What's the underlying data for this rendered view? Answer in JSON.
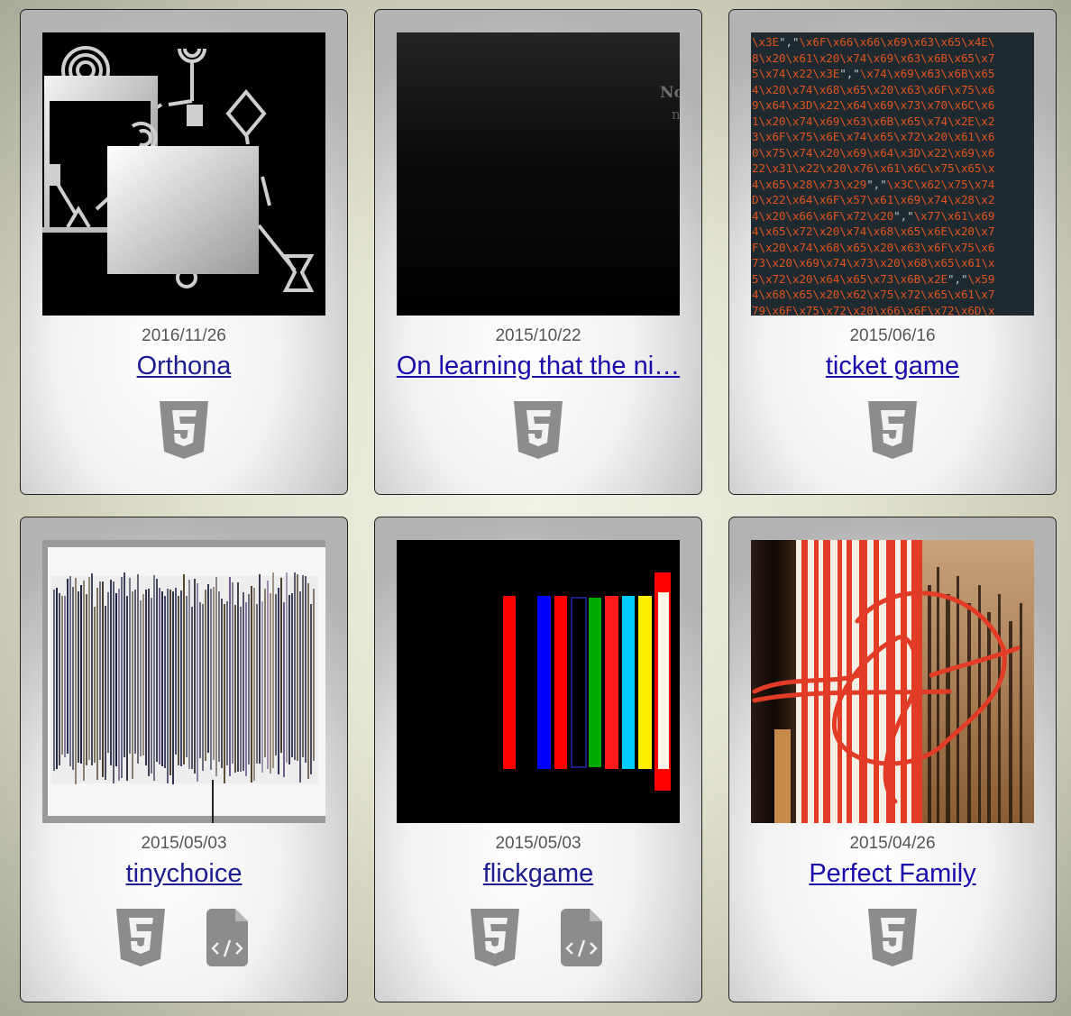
{
  "games": [
    {
      "date": "2016/11/26",
      "title": "Orthona",
      "thumbnail": "orthona-abstract-black-white-symbols",
      "icons": [
        "html5-icon"
      ]
    },
    {
      "date": "2015/10/22",
      "title": "On learning that the ni…",
      "thumbnail": "dark-screen-with-faint-text",
      "thumbnail_text": [
        "No",
        "n"
      ],
      "icons": [
        "html5-icon"
      ]
    },
    {
      "date": "2015/06/16",
      "title": "ticket game",
      "thumbnail": "orange-hex-escaped-code",
      "thumbnail_code": [
        "\\x3E\",\"\\x6F\\x66\\x66\\x69\\x63\\x65\\x4E\\",
        "8\\x20\\x61\\x20\\x74\\x69\\x63\\x6B\\x65\\x7",
        "5\\x74\\x22\\x3E\",\"\\x74\\x69\\x63\\x6B\\x65",
        "4\\x20\\x74\\x68\\x65\\x20\\x63\\x6F\\x75\\x6",
        "9\\x64\\x3D\\x22\\x64\\x69\\x73\\x70\\x6C\\x6",
        "1\\x20\\x74\\x69\\x63\\x6B\\x65\\x74\\x2E\\x2",
        "3\\x6F\\x75\\x6E\\x74\\x65\\x72\\x20\\x61\\x6",
        "0\\x75\\x74\\x20\\x69\\x64\\x3D\\x22\\x69\\x6",
        "22\\x31\\x22\\x20\\x76\\x61\\x6C\\x75\\x65\\x",
        "4\\x65\\x28\\x73\\x29\",\"\\x3C\\x62\\x75\\x74",
        "D\\x22\\x64\\x6F\\x57\\x61\\x69\\x74\\x28\\x2",
        "4\\x20\\x66\\x6F\\x72\\x20\",\"\\x77\\x61\\x69",
        "4\\x65\\x72\\x20\\x74\\x68\\x65\\x6E\\x20\\x7",
        "F\\x20\\x74\\x68\\x65\\x20\\x63\\x6F\\x75\\x6",
        "73\\x20\\x69\\x74\\x73\\x20\\x68\\x65\\x61\\x",
        "5\\x72\\x20\\x64\\x65\\x73\\x6B\\x2E\",\"\\x59",
        "4\\x68\\x65\\x20\\x62\\x75\\x72\\x65\\x61\\x7",
        "79\\x6F\\x75\\x72\\x20\\x66\\x6F\\x72\\x6D\\x"
      ],
      "icons": [
        "html5-icon"
      ]
    },
    {
      "date": "2015/05/03",
      "title": "tinychoice",
      "thumbnail": "stretched-glitch-text",
      "icons": [
        "html5-icon",
        "source-file-icon"
      ]
    },
    {
      "date": "2015/05/03",
      "title": "flickgame",
      "thumbnail": "colored-vertical-bars-on-black",
      "icons": [
        "html5-icon",
        "source-file-icon"
      ]
    },
    {
      "date": "2015/04/26",
      "title": "Perfect Family",
      "thumbnail": "red-stripes-with-scribble",
      "icons": [
        "html5-icon"
      ]
    }
  ],
  "colors": {
    "link": "#1a0dab",
    "date": "#555555",
    "icon": "#8c8c8c",
    "code": "#e0541f"
  }
}
